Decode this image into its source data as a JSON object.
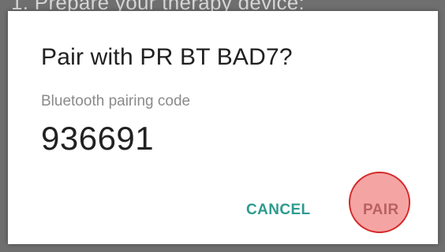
{
  "background": {
    "instruction_text": "1. Prepare your therapy device:"
  },
  "dialog": {
    "title": "Pair with PR BT BAD7?",
    "subtitle": "Bluetooth pairing code",
    "code": "936691",
    "cancel_label": "CANCEL",
    "pair_label": "PAIR"
  },
  "colors": {
    "accent": "#2e9b8f",
    "highlight_fill": "#ec5a5a",
    "highlight_border": "#d42a2a"
  }
}
